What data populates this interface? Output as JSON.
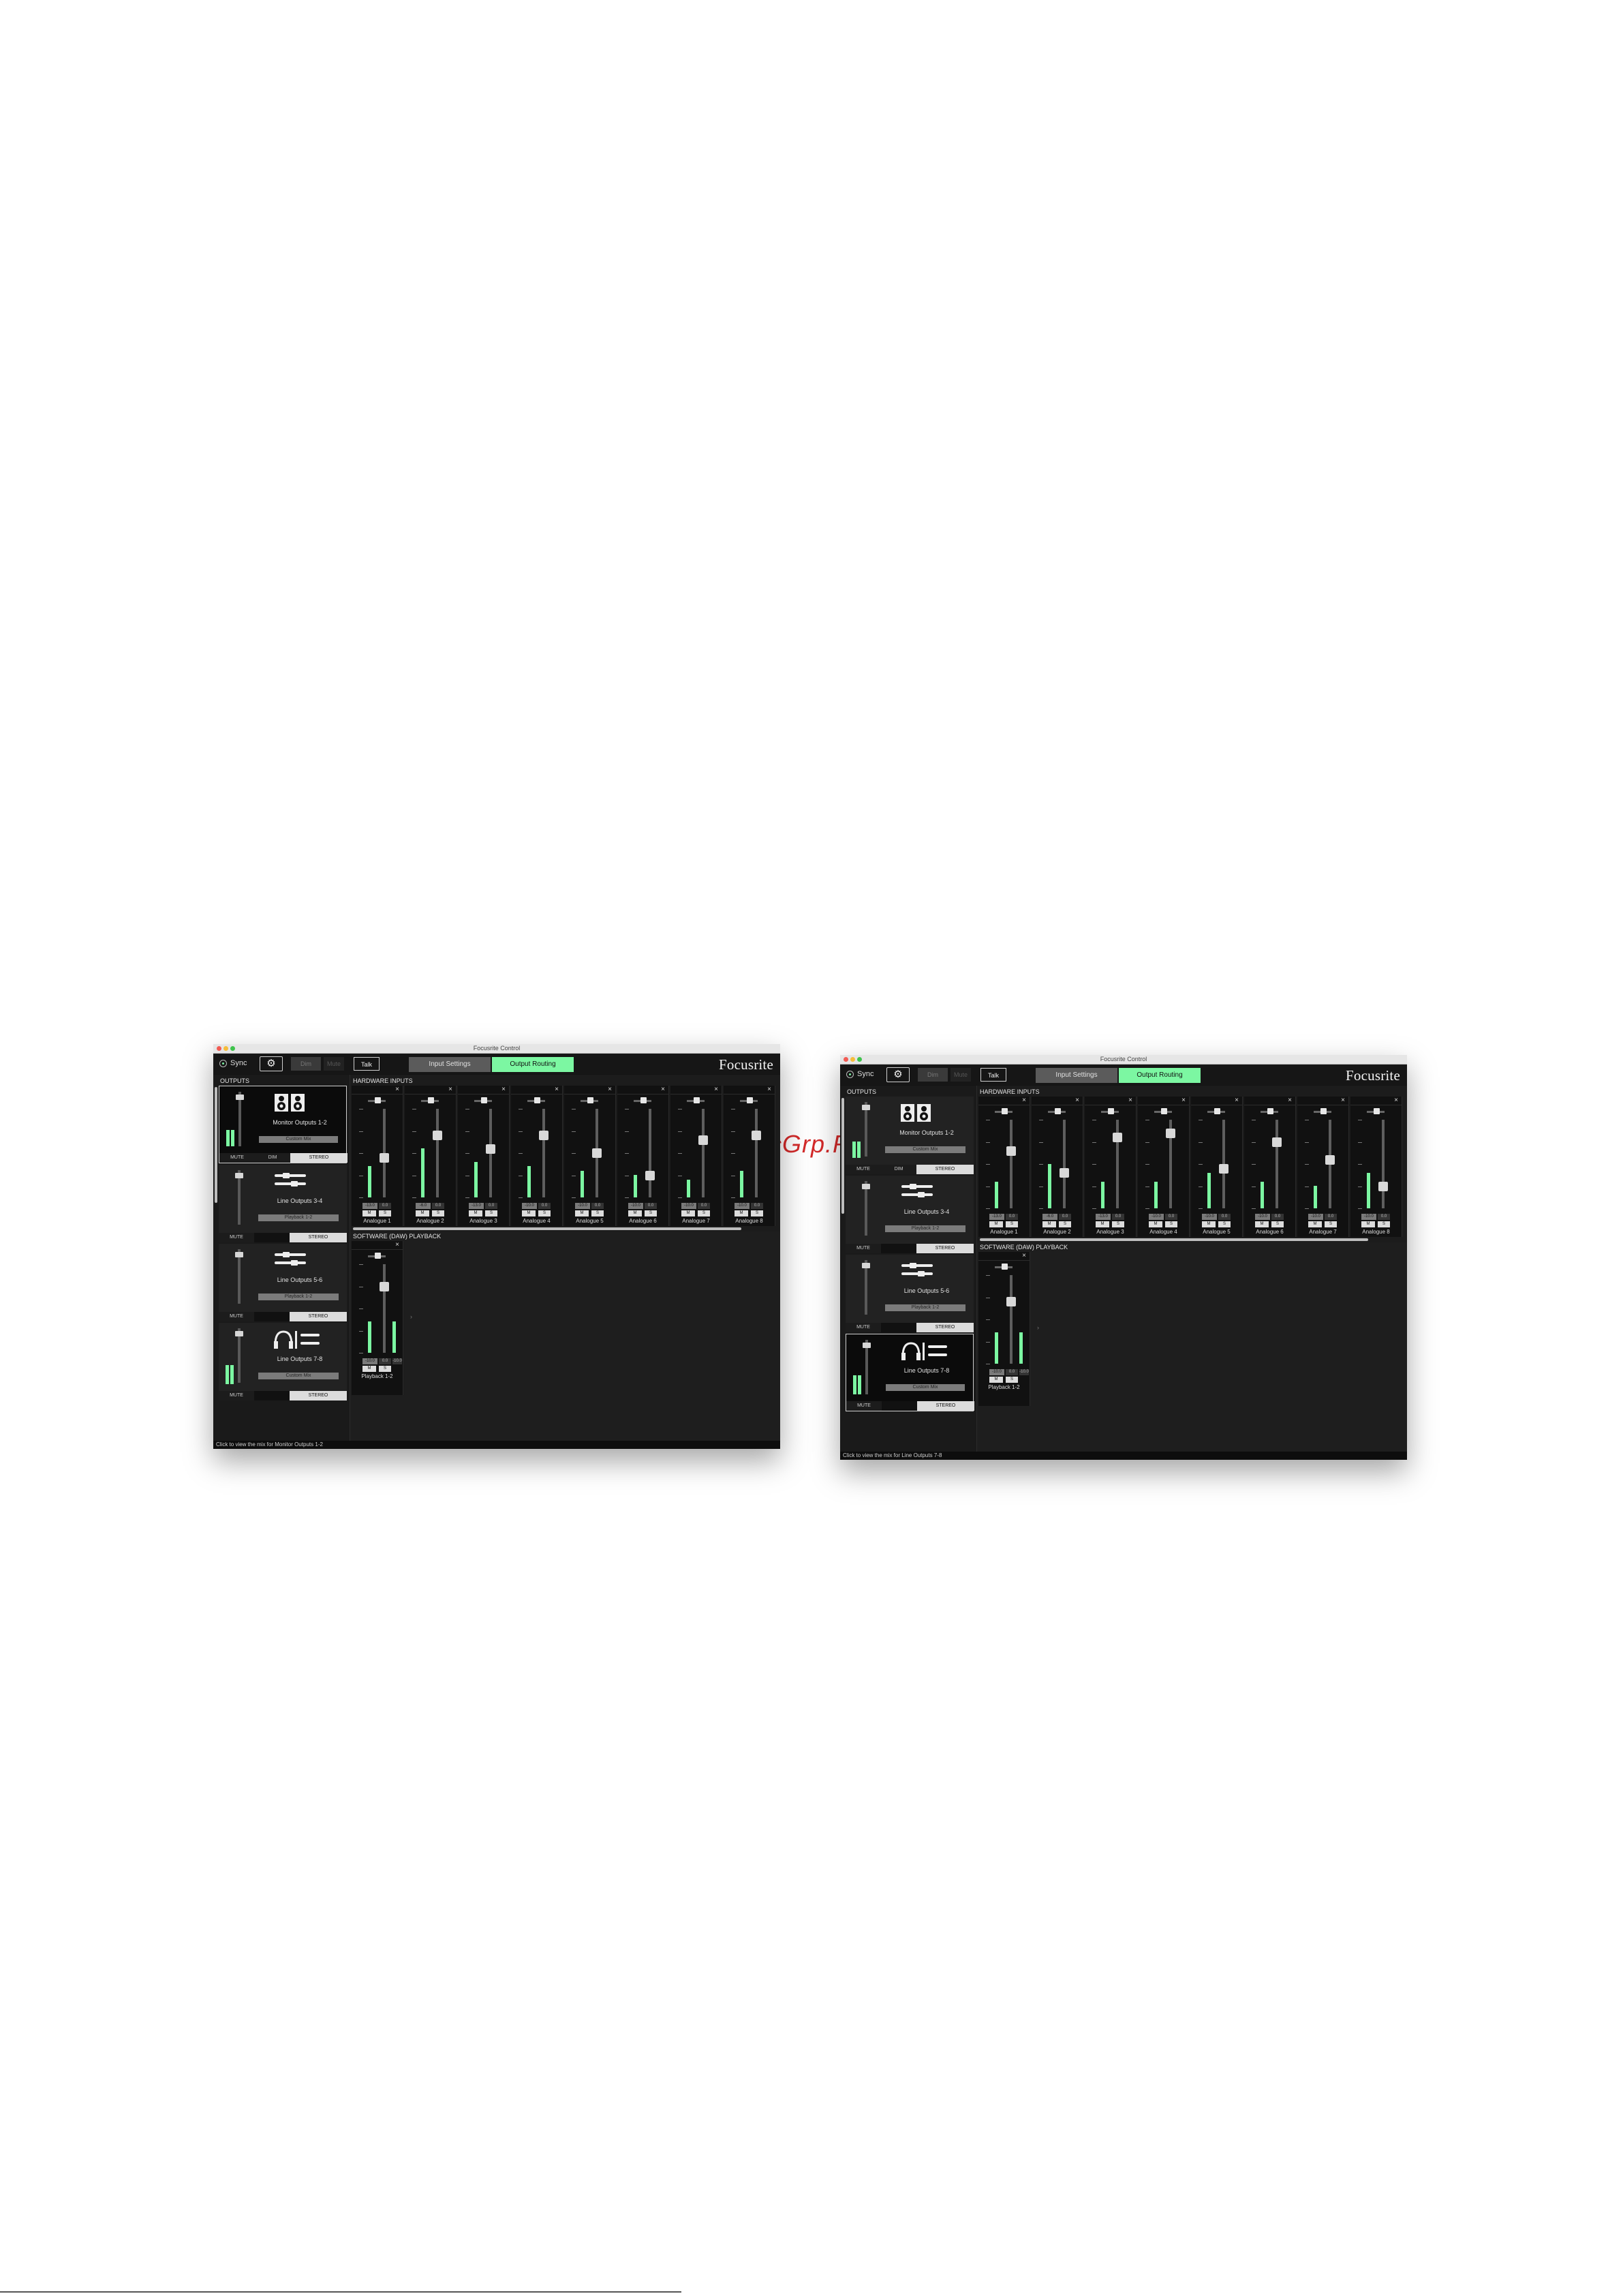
{
  "watermark": "McGrp.Ru",
  "footer_text": "",
  "windows": [
    {
      "title": "Focusrite Control",
      "sync_label": "Sync",
      "toolbar": {
        "dim": "Dim",
        "mute": "Mute",
        "talk": "Talk"
      },
      "tabs": [
        {
          "label": "Input Settings",
          "active": false
        },
        {
          "label": "Output Routing",
          "active": true
        }
      ],
      "logo": "Focusrite",
      "outputs_heading": "OUTPUTS",
      "hardware_heading": "HARDWARE INPUTS",
      "daw_heading": "SOFTWARE (DAW) PLAYBACK",
      "outputs": [
        {
          "name": "Monitor Outputs 1-2",
          "mix": "Custom Mix",
          "icon": "speaker-icon",
          "selected": true,
          "buttons": [
            "MUTE",
            "DIM",
            "STEREO"
          ],
          "level": 0.3
        },
        {
          "name": "Line Outputs 3-4",
          "mix": "Playback 1-2",
          "icon": "jack-cable-icon",
          "selected": false,
          "buttons": [
            "MUTE",
            "STEREO"
          ],
          "level": 0
        },
        {
          "name": "Line Outputs 5-6",
          "mix": "Playback 1-2",
          "icon": "jack-cable-icon",
          "selected": false,
          "buttons": [
            "MUTE",
            "STEREO"
          ],
          "level": 0
        },
        {
          "name": "Line Outputs 7-8",
          "mix": "Custom Mix",
          "icon": "headphones-icon",
          "selected": false,
          "buttons": [
            "MUTE",
            "STEREO"
          ],
          "level": 0.35
        }
      ],
      "hardware_inputs": [
        {
          "name": "Analogue 1",
          "v1": "-13.0",
          "v2": "0.0",
          "fader": 0.45,
          "meter": 0.35
        },
        {
          "name": "Analogue 2",
          "v1": "-6.0",
          "v2": "0.0",
          "fader": 0.7,
          "meter": 0.55
        },
        {
          "name": "Analogue 3",
          "v1": "-13.0",
          "v2": "0.0",
          "fader": 0.55,
          "meter": 0.4
        },
        {
          "name": "Analogue 4",
          "v1": "-10.0",
          "v2": "0.0",
          "fader": 0.7,
          "meter": 0.35
        },
        {
          "name": "Analogue 5",
          "v1": "-10.0",
          "v2": "0.0",
          "fader": 0.5,
          "meter": 0.3
        },
        {
          "name": "Analogue 6",
          "v1": "-10.0",
          "v2": "0.0",
          "fader": 0.25,
          "meter": 0.25
        },
        {
          "name": "Analogue 7",
          "v1": "-10.0",
          "v2": "0.0",
          "fader": 0.65,
          "meter": 0.2
        },
        {
          "name": "Analogue 8",
          "v1": "-10.0",
          "v2": "0.0",
          "fader": 0.7,
          "meter": 0.3
        }
      ],
      "daw_strip": {
        "name": "Playback 1-2",
        "v1": "-10.0",
        "v2": "0.0",
        "v3": "-10.0",
        "fader": 0.75,
        "meter": 0.35
      },
      "status": "Click to view the mix for Monitor Outputs 1-2"
    },
    {
      "title": "Focusrite Control",
      "sync_label": "Sync",
      "toolbar": {
        "dim": "Dim",
        "mute": "Mute",
        "talk": "Talk"
      },
      "tabs": [
        {
          "label": "Input Settings",
          "active": false
        },
        {
          "label": "Output Routing",
          "active": true
        }
      ],
      "logo": "Focusrite",
      "outputs_heading": "OUTPUTS",
      "hardware_heading": "HARDWARE INPUTS",
      "daw_heading": "SOFTWARE (DAW) PLAYBACK",
      "outputs": [
        {
          "name": "Monitor Outputs 1-2",
          "mix": "Custom Mix",
          "icon": "speaker-icon",
          "selected": false,
          "buttons": [
            "MUTE",
            "DIM",
            "STEREO"
          ],
          "level": 0.3
        },
        {
          "name": "Line Outputs 3-4",
          "mix": "Playback 1-2",
          "icon": "jack-cable-icon",
          "selected": false,
          "buttons": [
            "MUTE",
            "STEREO"
          ],
          "level": 0
        },
        {
          "name": "Line Outputs 5-6",
          "mix": "Playback 1-2",
          "icon": "jack-cable-icon",
          "selected": false,
          "buttons": [
            "MUTE",
            "STEREO"
          ],
          "level": 0
        },
        {
          "name": "Line Outputs 7-8",
          "mix": "Custom Mix",
          "icon": "headphones-icon",
          "selected": true,
          "buttons": [
            "MUTE",
            "STEREO"
          ],
          "level": 0.35
        }
      ],
      "hardware_inputs": [
        {
          "name": "Analogue 1",
          "v1": "-13.0",
          "v2": "0.0",
          "fader": 0.65,
          "meter": 0.3
        },
        {
          "name": "Analogue 2",
          "v1": "-6.0",
          "v2": "0.0",
          "fader": 0.4,
          "meter": 0.5
        },
        {
          "name": "Analogue 3",
          "v1": "-13.0",
          "v2": "0.0",
          "fader": 0.8,
          "meter": 0.3
        },
        {
          "name": "Analogue 4",
          "v1": "-10.0",
          "v2": "0.0",
          "fader": 0.85,
          "meter": 0.3
        },
        {
          "name": "Analogue 5",
          "v1": "-10.0",
          "v2": "0.0",
          "fader": 0.45,
          "meter": 0.4
        },
        {
          "name": "Analogue 6",
          "v1": "-10.0",
          "v2": "0.0",
          "fader": 0.75,
          "meter": 0.3
        },
        {
          "name": "Analogue 7",
          "v1": "-10.0",
          "v2": "0.0",
          "fader": 0.55,
          "meter": 0.25
        },
        {
          "name": "Analogue 8",
          "v1": "-10.0",
          "v2": "0.0",
          "fader": 0.25,
          "meter": 0.4
        }
      ],
      "daw_strip": {
        "name": "Playback 1-2",
        "v1": "-10.0",
        "v2": "0.0",
        "v3": "-10.0",
        "fader": 0.7,
        "meter": 0.35
      },
      "status": "Click to view the mix for Line Outputs 7-8"
    }
  ]
}
